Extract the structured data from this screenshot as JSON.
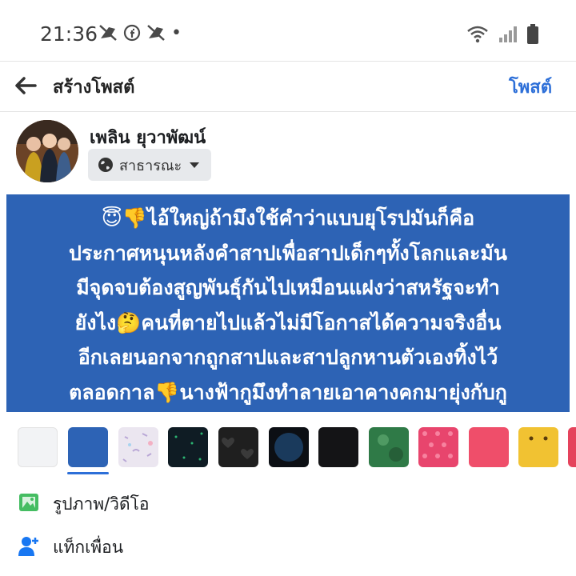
{
  "status_bar": {
    "time": "21:36",
    "dot": "•"
  },
  "header": {
    "title": "สร้างโพสต์",
    "post_button": "โพสต์"
  },
  "user": {
    "name": "เพลิน ยุวาพัฒน์",
    "privacy": "สาธารณะ"
  },
  "post": {
    "lines": [
      "😇👎ไอ้ใหญ่ถ้ามึงใช้คำว่าแบบยุโรปมันก็คือ",
      "ประกาศหนุนหลังคำสาปเพื่อสาปเด็กๆทั้งโลกและมัน",
      "มีจุดจบต้องสูญพันธุ์กันไปเหมือนแฝงว่าสหรัฐจะทำ",
      "ยังไง🤔คนที่ตายไปแล้วไม่มีโอกาสได้ความจริงอื่น",
      "อีกเลยนอกจากถูกสาปและสาปลูกหานตัวเองทิ้งไว้",
      "ตลอดกาล👎นางฟ้ากูมึงทำลายเอาคางคกมายุ่งกับกู"
    ],
    "background_color": "#2d63b5"
  },
  "background_swatches": [
    {
      "name": "swatch-white",
      "color": "#f2f3f5"
    },
    {
      "name": "swatch-blue",
      "color": "#2d63b5",
      "selected": true
    },
    {
      "name": "swatch-pastel-pattern",
      "color": "#e9e4ef"
    },
    {
      "name": "swatch-dark-dots",
      "color": "#0f1c24"
    },
    {
      "name": "swatch-black-hearts",
      "color": "#1f1f1f"
    },
    {
      "name": "swatch-dark-circle",
      "color": "#0c1a2a"
    },
    {
      "name": "swatch-black-night",
      "color": "#141416"
    },
    {
      "name": "swatch-green",
      "color": "#2f7a47"
    },
    {
      "name": "swatch-pink-hearts",
      "color": "#e8456d"
    },
    {
      "name": "swatch-coral",
      "color": "#ef4e6a"
    },
    {
      "name": "swatch-yellow-face",
      "color": "#f1c232"
    },
    {
      "name": "swatch-red-partial",
      "color": "#e5435c"
    }
  ],
  "options": [
    {
      "label": "รูปภาพ/วิดีโอ",
      "icon": "photo-icon"
    },
    {
      "label": "แท็กเพื่อน",
      "icon": "tag-friend-icon"
    }
  ]
}
